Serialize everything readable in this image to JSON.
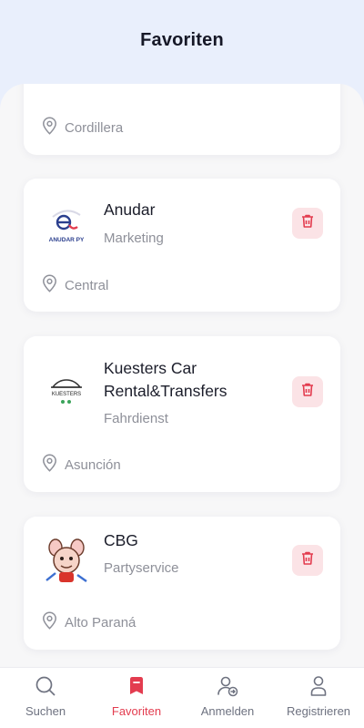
{
  "header": {
    "title": "Favoriten"
  },
  "favorites": [
    {
      "location": "Cordillera"
    },
    {
      "name": "Anudar",
      "category": "Marketing",
      "location": "Central",
      "logo_text": "ANUDAR PY",
      "logo_mark": "e"
    },
    {
      "name": "Kuesters Car Rental&Transfers",
      "category": "Fahrdienst",
      "location": "Asunción",
      "logo_text": "KUESTERS"
    },
    {
      "name": "CBG",
      "category": "Partyservice",
      "location": "Alto Paraná"
    }
  ],
  "nav": [
    {
      "label": "Suchen",
      "icon": "search-icon",
      "active": false
    },
    {
      "label": "Favoriten",
      "icon": "bookmark-icon",
      "active": true
    },
    {
      "label": "Anmelden",
      "icon": "login-user-icon",
      "active": false
    },
    {
      "label": "Registrieren",
      "icon": "person-icon",
      "active": false
    }
  ],
  "colors": {
    "accent": "#e33c4f",
    "header_bg": "#e9effc",
    "delete_bg": "#fbe3e6",
    "muted_text": "#8e9099"
  }
}
